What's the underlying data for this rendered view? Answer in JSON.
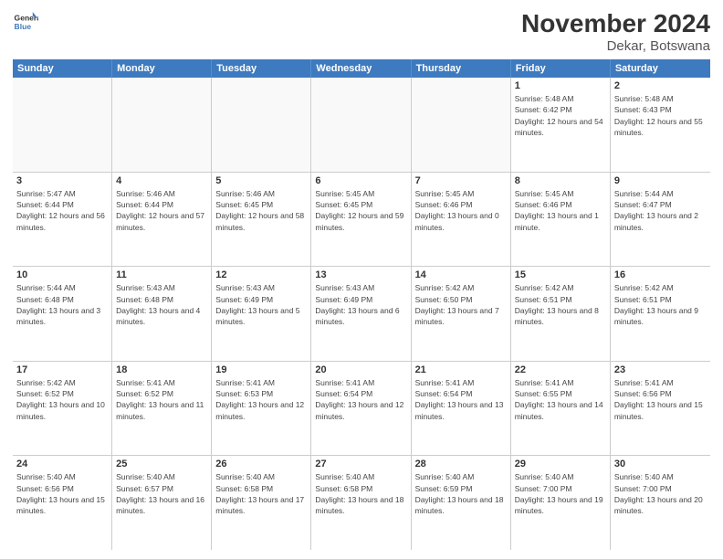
{
  "logo": {
    "line1": "General",
    "line2": "Blue"
  },
  "title": "November 2024",
  "subtitle": "Dekar, Botswana",
  "header_days": [
    "Sunday",
    "Monday",
    "Tuesday",
    "Wednesday",
    "Thursday",
    "Friday",
    "Saturday"
  ],
  "rows": [
    [
      {
        "day": "",
        "info": "",
        "empty": true
      },
      {
        "day": "",
        "info": "",
        "empty": true
      },
      {
        "day": "",
        "info": "",
        "empty": true
      },
      {
        "day": "",
        "info": "",
        "empty": true
      },
      {
        "day": "",
        "info": "",
        "empty": true
      },
      {
        "day": "1",
        "info": "Sunrise: 5:48 AM\nSunset: 6:42 PM\nDaylight: 12 hours and 54 minutes."
      },
      {
        "day": "2",
        "info": "Sunrise: 5:48 AM\nSunset: 6:43 PM\nDaylight: 12 hours and 55 minutes."
      }
    ],
    [
      {
        "day": "3",
        "info": "Sunrise: 5:47 AM\nSunset: 6:44 PM\nDaylight: 12 hours and 56 minutes."
      },
      {
        "day": "4",
        "info": "Sunrise: 5:46 AM\nSunset: 6:44 PM\nDaylight: 12 hours and 57 minutes."
      },
      {
        "day": "5",
        "info": "Sunrise: 5:46 AM\nSunset: 6:45 PM\nDaylight: 12 hours and 58 minutes."
      },
      {
        "day": "6",
        "info": "Sunrise: 5:45 AM\nSunset: 6:45 PM\nDaylight: 12 hours and 59 minutes."
      },
      {
        "day": "7",
        "info": "Sunrise: 5:45 AM\nSunset: 6:46 PM\nDaylight: 13 hours and 0 minutes."
      },
      {
        "day": "8",
        "info": "Sunrise: 5:45 AM\nSunset: 6:46 PM\nDaylight: 13 hours and 1 minute."
      },
      {
        "day": "9",
        "info": "Sunrise: 5:44 AM\nSunset: 6:47 PM\nDaylight: 13 hours and 2 minutes."
      }
    ],
    [
      {
        "day": "10",
        "info": "Sunrise: 5:44 AM\nSunset: 6:48 PM\nDaylight: 13 hours and 3 minutes."
      },
      {
        "day": "11",
        "info": "Sunrise: 5:43 AM\nSunset: 6:48 PM\nDaylight: 13 hours and 4 minutes."
      },
      {
        "day": "12",
        "info": "Sunrise: 5:43 AM\nSunset: 6:49 PM\nDaylight: 13 hours and 5 minutes."
      },
      {
        "day": "13",
        "info": "Sunrise: 5:43 AM\nSunset: 6:49 PM\nDaylight: 13 hours and 6 minutes."
      },
      {
        "day": "14",
        "info": "Sunrise: 5:42 AM\nSunset: 6:50 PM\nDaylight: 13 hours and 7 minutes."
      },
      {
        "day": "15",
        "info": "Sunrise: 5:42 AM\nSunset: 6:51 PM\nDaylight: 13 hours and 8 minutes."
      },
      {
        "day": "16",
        "info": "Sunrise: 5:42 AM\nSunset: 6:51 PM\nDaylight: 13 hours and 9 minutes."
      }
    ],
    [
      {
        "day": "17",
        "info": "Sunrise: 5:42 AM\nSunset: 6:52 PM\nDaylight: 13 hours and 10 minutes."
      },
      {
        "day": "18",
        "info": "Sunrise: 5:41 AM\nSunset: 6:52 PM\nDaylight: 13 hours and 11 minutes."
      },
      {
        "day": "19",
        "info": "Sunrise: 5:41 AM\nSunset: 6:53 PM\nDaylight: 13 hours and 12 minutes."
      },
      {
        "day": "20",
        "info": "Sunrise: 5:41 AM\nSunset: 6:54 PM\nDaylight: 13 hours and 12 minutes."
      },
      {
        "day": "21",
        "info": "Sunrise: 5:41 AM\nSunset: 6:54 PM\nDaylight: 13 hours and 13 minutes."
      },
      {
        "day": "22",
        "info": "Sunrise: 5:41 AM\nSunset: 6:55 PM\nDaylight: 13 hours and 14 minutes."
      },
      {
        "day": "23",
        "info": "Sunrise: 5:41 AM\nSunset: 6:56 PM\nDaylight: 13 hours and 15 minutes."
      }
    ],
    [
      {
        "day": "24",
        "info": "Sunrise: 5:40 AM\nSunset: 6:56 PM\nDaylight: 13 hours and 15 minutes."
      },
      {
        "day": "25",
        "info": "Sunrise: 5:40 AM\nSunset: 6:57 PM\nDaylight: 13 hours and 16 minutes."
      },
      {
        "day": "26",
        "info": "Sunrise: 5:40 AM\nSunset: 6:58 PM\nDaylight: 13 hours and 17 minutes."
      },
      {
        "day": "27",
        "info": "Sunrise: 5:40 AM\nSunset: 6:58 PM\nDaylight: 13 hours and 18 minutes."
      },
      {
        "day": "28",
        "info": "Sunrise: 5:40 AM\nSunset: 6:59 PM\nDaylight: 13 hours and 18 minutes."
      },
      {
        "day": "29",
        "info": "Sunrise: 5:40 AM\nSunset: 7:00 PM\nDaylight: 13 hours and 19 minutes."
      },
      {
        "day": "30",
        "info": "Sunrise: 5:40 AM\nSunset: 7:00 PM\nDaylight: 13 hours and 20 minutes."
      }
    ]
  ]
}
